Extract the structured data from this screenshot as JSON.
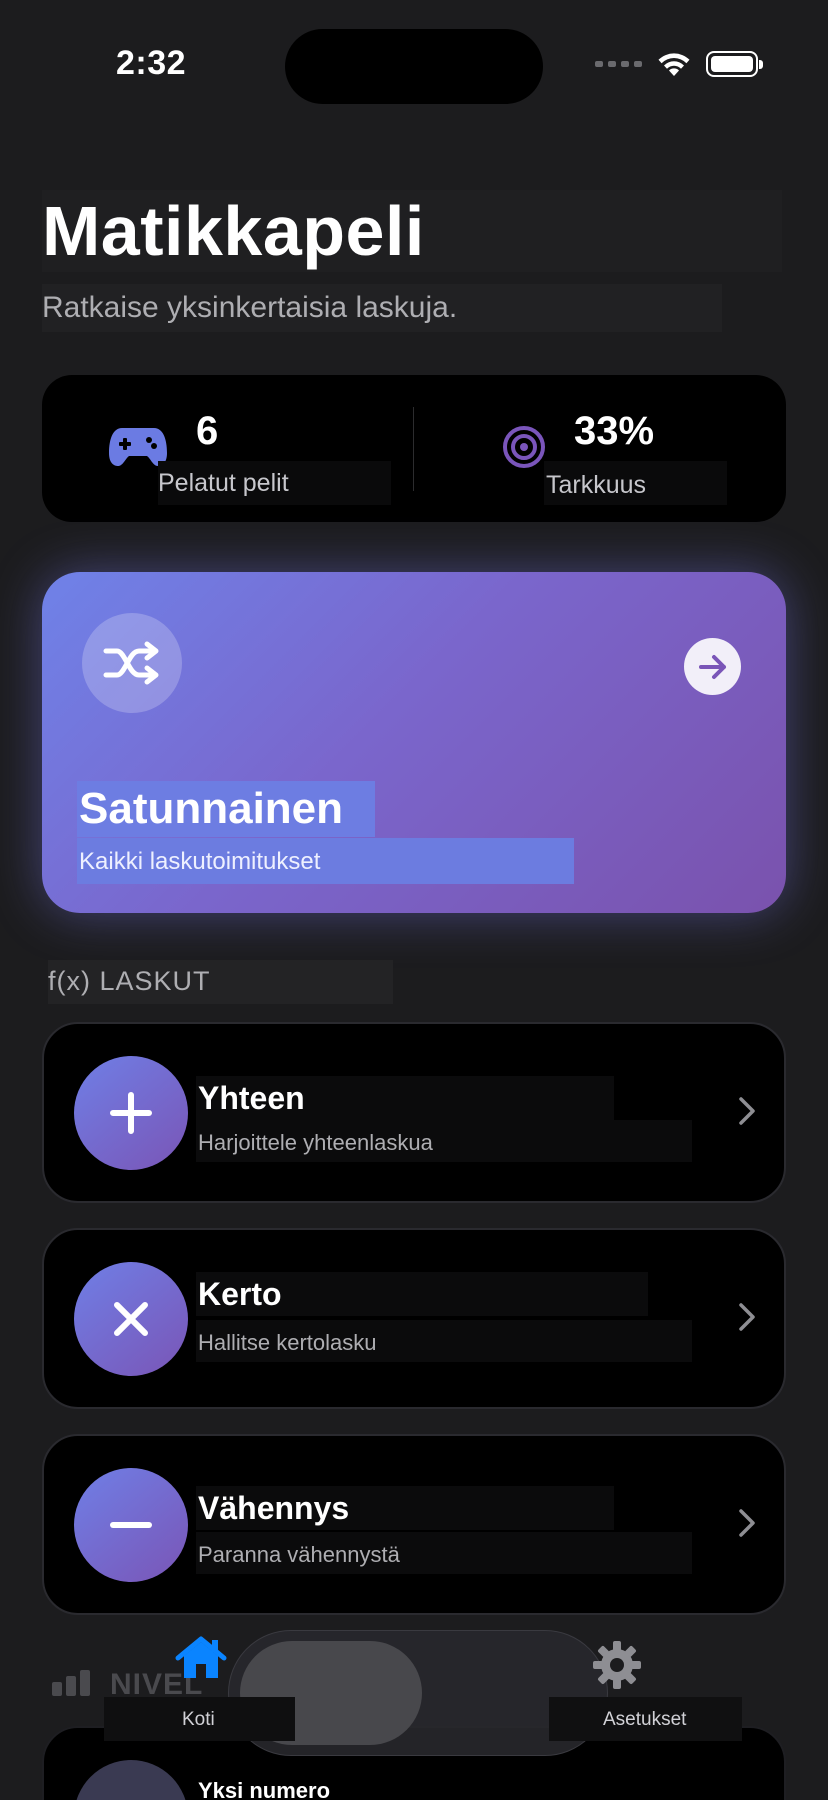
{
  "status_bar": {
    "time": "2:32"
  },
  "header": {
    "title": "Matikkapeli",
    "subtitle": "Ratkaise yksinkertaisia laskuja."
  },
  "stats": {
    "games_icon": "gamecontroller-icon",
    "games_value": "6",
    "games_label": "Pelatut pelit",
    "accuracy_icon": "target-icon",
    "accuracy_value": "33%",
    "accuracy_label": "Tarkkuus"
  },
  "random_card": {
    "icon": "shuffle-icon",
    "title": "Satunnainen",
    "subtitle": "Kaikki laskutoimitukset",
    "action_icon": "arrow-right-icon"
  },
  "operations_section": {
    "header": "f(x) LASKUT",
    "items": [
      {
        "icon": "plus-icon",
        "title": "Yhteen",
        "subtitle": "Harjoittele yhteenlaskua"
      },
      {
        "icon": "multiply-icon",
        "title": "Kerto",
        "subtitle": "Hallitse kertolasku"
      },
      {
        "icon": "minus-icon",
        "title": "Vähennys",
        "subtitle": "Paranna vähennystä"
      }
    ]
  },
  "level_section": {
    "header_visible": "NIVEL",
    "first_item_title": "Yksi numero"
  },
  "tab_bar": {
    "items": [
      {
        "icon": "house-icon",
        "label": "Koti",
        "active": true
      },
      {
        "icon": "gear-icon",
        "label": "Asetukset",
        "active": false
      }
    ]
  },
  "colors": {
    "background": "#1c1c1e",
    "card": "#000000",
    "accent_blue": "#6f82e8",
    "accent_purple": "#7a52ad",
    "tab_active": "#0a84ff"
  }
}
